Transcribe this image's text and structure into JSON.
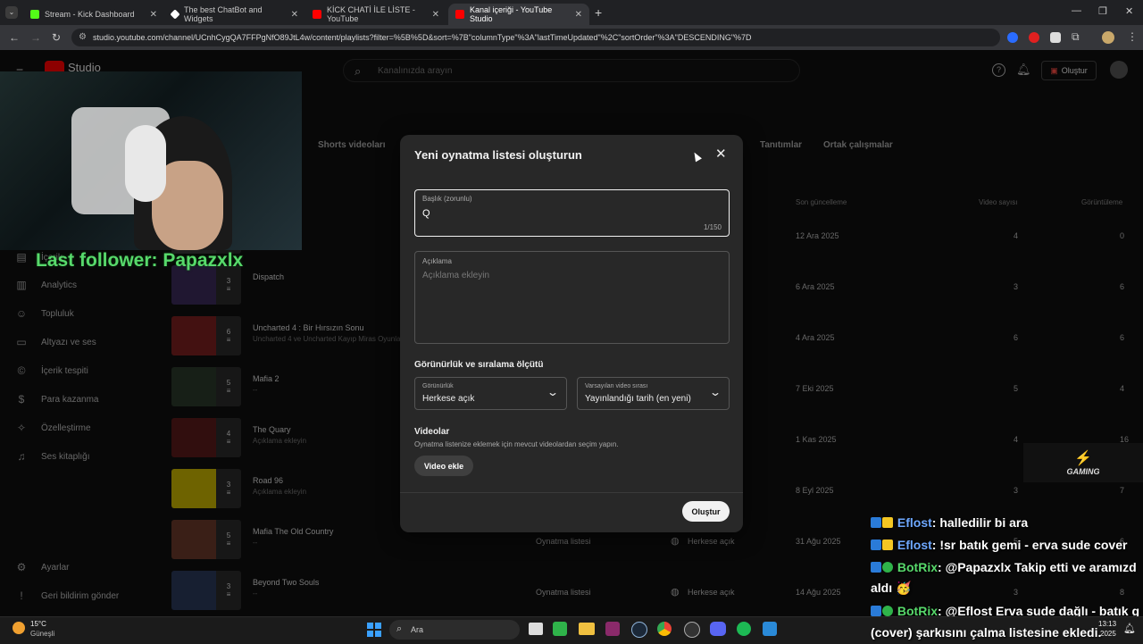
{
  "browser": {
    "tabs": [
      {
        "label": "Stream - Kick Dashboard",
        "color": "#53fc18"
      },
      {
        "label": "The best ChatBot and Widgets",
        "color": "#ffffff"
      },
      {
        "label": "KİCK CHATİ İLE LİSTE - YouTube",
        "color": "#ff0000"
      },
      {
        "label": "Kanal içeriği - YouTube Studio",
        "color": "#ff0000"
      }
    ],
    "url": "studio.youtube.com/channel/UCnhCygQA7FFPgNfO89JtL4w/content/playlists?filter=%5B%5D&sort=%7B\"columnType\"%3A\"lastTimeUpdated\"%2C\"sortOrder\"%3A\"DESCENDING\"%7D"
  },
  "studio": {
    "logo": "Studio",
    "search_placeholder": "Kanalınızda arayın",
    "create_label": "Oluştur",
    "tabs": [
      "Shorts videoları",
      "Tanıtımlar",
      "Ortak çalışmalar"
    ],
    "columns": {
      "updated": "Son güncelleme",
      "videos": "Video sayısı",
      "views": "Görüntüleme"
    },
    "sidebar": [
      {
        "label": "İçerik",
        "icon": "content-icon"
      },
      {
        "label": "Analytics",
        "icon": "analytics-icon"
      },
      {
        "label": "Topluluk",
        "icon": "community-icon"
      },
      {
        "label": "Altyazı ve ses",
        "icon": "subtitles-icon"
      },
      {
        "label": "İçerik tespiti",
        "icon": "copyright-icon"
      },
      {
        "label": "Para kazanma",
        "icon": "dollar-icon"
      },
      {
        "label": "Özelleştirme",
        "icon": "magic-wand-icon"
      },
      {
        "label": "Ses kitaplığı",
        "icon": "audio-library-icon"
      }
    ],
    "sidebar_bottom": [
      {
        "label": "Ayarlar",
        "icon": "gear-icon"
      },
      {
        "label": "Geri bildirim gönder",
        "icon": "feedback-icon"
      }
    ],
    "rows": [
      {
        "title": "",
        "subtitle": "",
        "count": "",
        "type": "",
        "visibility": "",
        "updated": "12 Ara 2025",
        "videos": "4",
        "views": "0",
        "color": "#3a3a3a"
      },
      {
        "title": "Dispatch",
        "subtitle": "",
        "count": "3",
        "type": "",
        "visibility": "",
        "updated": "6 Ara 2025",
        "videos": "3",
        "views": "6",
        "color": "#3b2a5a"
      },
      {
        "title": "Uncharted 4 : Bir Hırsızın Sonu",
        "subtitle": "Uncharted 4 ve Uncharted Kayıp Miras Oyunla",
        "count": "6",
        "type": "",
        "visibility": "",
        "updated": "4 Ara 2025",
        "videos": "6",
        "views": "6",
        "color": "#7a2020"
      },
      {
        "title": "Mafia 2",
        "subtitle": "--",
        "count": "5",
        "type": "",
        "visibility": "",
        "updated": "7 Eki 2025",
        "videos": "5",
        "views": "4",
        "color": "#2a3a2a"
      },
      {
        "title": "The Quary",
        "subtitle": "Açıklama ekleyin",
        "count": "4",
        "type": "",
        "visibility": "",
        "updated": "1 Kas 2025",
        "videos": "4",
        "views": "16",
        "color": "#5a1a1a"
      },
      {
        "title": "Road 96",
        "subtitle": "Açıklama ekleyin",
        "count": "3",
        "type": "",
        "visibility": "",
        "updated": "8 Eyl 2025",
        "videos": "3",
        "views": "7",
        "color": "#c8b400"
      },
      {
        "title": "Mafia The Old Country",
        "subtitle": "--",
        "count": "5",
        "type": "Oynatma listesi",
        "visibility": "Herkese açık",
        "updated": "31 Ağu 2025",
        "videos": "5",
        "views": "6",
        "color": "#6a3a2a"
      },
      {
        "title": "Beyond Two Souls",
        "subtitle": "--",
        "count": "3",
        "type": "Oynatma listesi",
        "visibility": "Herkese açık",
        "updated": "14 Ağu 2025",
        "videos": "3",
        "views": "8",
        "color": "#2a3a5a"
      }
    ]
  },
  "overlay": {
    "follower": "Last follower: Papazxlx",
    "gaming_logo": "GAMING",
    "chat": [
      {
        "user": "Eflost",
        "msg": ": halledilir bi ara",
        "color": "#6ea8ff"
      },
      {
        "user": "Eflost",
        "msg": ": !sr batık gemi - erva sude cover",
        "color": "#6ea8ff"
      },
      {
        "user": "BotRix",
        "msg": ": @Papazxlx Takip etti ve aramızd",
        "color": "#57d96b"
      },
      {
        "user": "",
        "msg": "aldı 🥳",
        "color": "#57d96b"
      },
      {
        "user": "BotRix",
        "msg": ": @Eflost Erva sude dağlı - batık g",
        "color": "#57d96b"
      },
      {
        "user": "",
        "msg": "(cover) şarkısını çalma listesine ekledi.",
        "color": "#57d96b"
      }
    ]
  },
  "modal": {
    "title": "Yeni oynatma listesi oluşturun",
    "title_label": "Başlık (zorunlu)",
    "title_value": "Q",
    "title_counter": "1/150",
    "desc_label": "Açıklama",
    "desc_placeholder": "Açıklama ekleyin",
    "section_visibility": "Görünürlük ve sıralama ölçütü",
    "visibility_label": "Görünürlük",
    "visibility_value": "Herkese açık",
    "order_label": "Varsayılan video sırası",
    "order_value": "Yayınlandığı tarih (en yeni)",
    "videos_heading": "Videolar",
    "videos_desc": "Oynatma listenize eklemek için mevcut videolardan seçim yapın.",
    "add_video": "Video ekle",
    "create": "Oluştur"
  },
  "taskbar": {
    "weather_temp": "15°C",
    "weather_desc": "Güneşli",
    "search": "Ara",
    "time": "13:13",
    "date": "2025"
  }
}
